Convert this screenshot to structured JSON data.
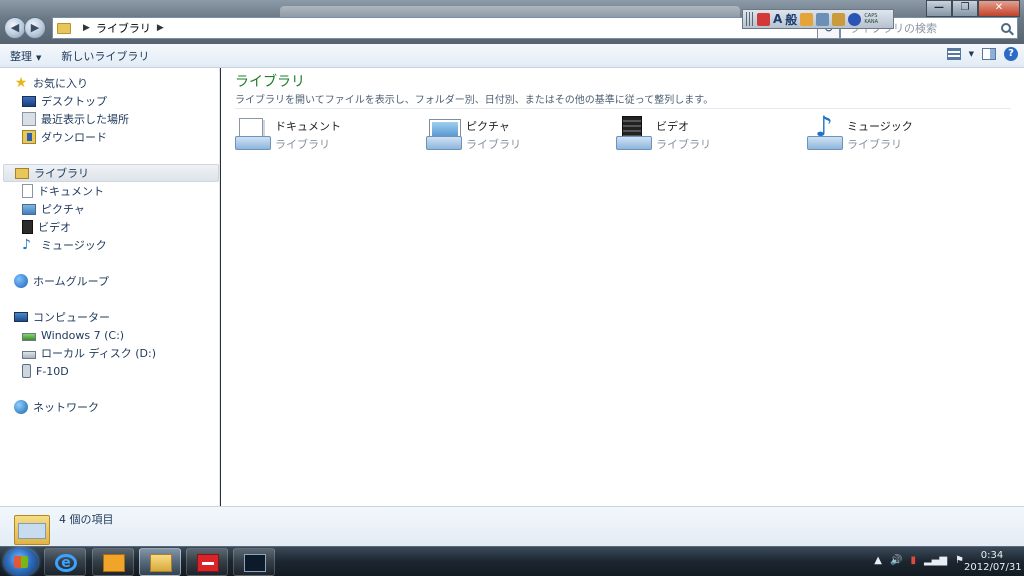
{
  "window": {
    "address_crumb": "ライブラリ",
    "search_placeholder": "ライブラリの検索"
  },
  "langbar": {
    "ime_letter": "A",
    "ime_mode": "般",
    "caps": "CAPS",
    "kana": "KANA"
  },
  "toolbar": {
    "organize_label": "整理",
    "new_library_label": "新しいライブラリ"
  },
  "nav": {
    "favorites": "お気に入り",
    "desktop": "デスクトップ",
    "recent": "最近表示した場所",
    "downloads": "ダウンロード",
    "libraries": "ライブラリ",
    "documents": "ドキュメント",
    "pictures": "ピクチャ",
    "videos": "ビデオ",
    "music": "ミュージック",
    "homegroup": "ホームグループ",
    "computer": "コンピューター",
    "drive_c": "Windows 7 (C:)",
    "drive_d": "ローカル ディスク (D:)",
    "device": "F-10D",
    "network": "ネットワーク"
  },
  "content": {
    "title": "ライブラリ",
    "description": "ライブラリを開いてファイルを表示し、フォルダー別、日付別、またはその他の基準に従って整列します。",
    "items": [
      {
        "name": "ドキュメント",
        "type": "ライブラリ"
      },
      {
        "name": "ピクチャ",
        "type": "ライブラリ"
      },
      {
        "name": "ビデオ",
        "type": "ライブラリ"
      },
      {
        "name": "ミュージック",
        "type": "ライブラリ"
      }
    ]
  },
  "status": {
    "item_count": "4 個の項目"
  },
  "taskbar": {
    "time": "0:34",
    "date": "2012/07/31"
  }
}
